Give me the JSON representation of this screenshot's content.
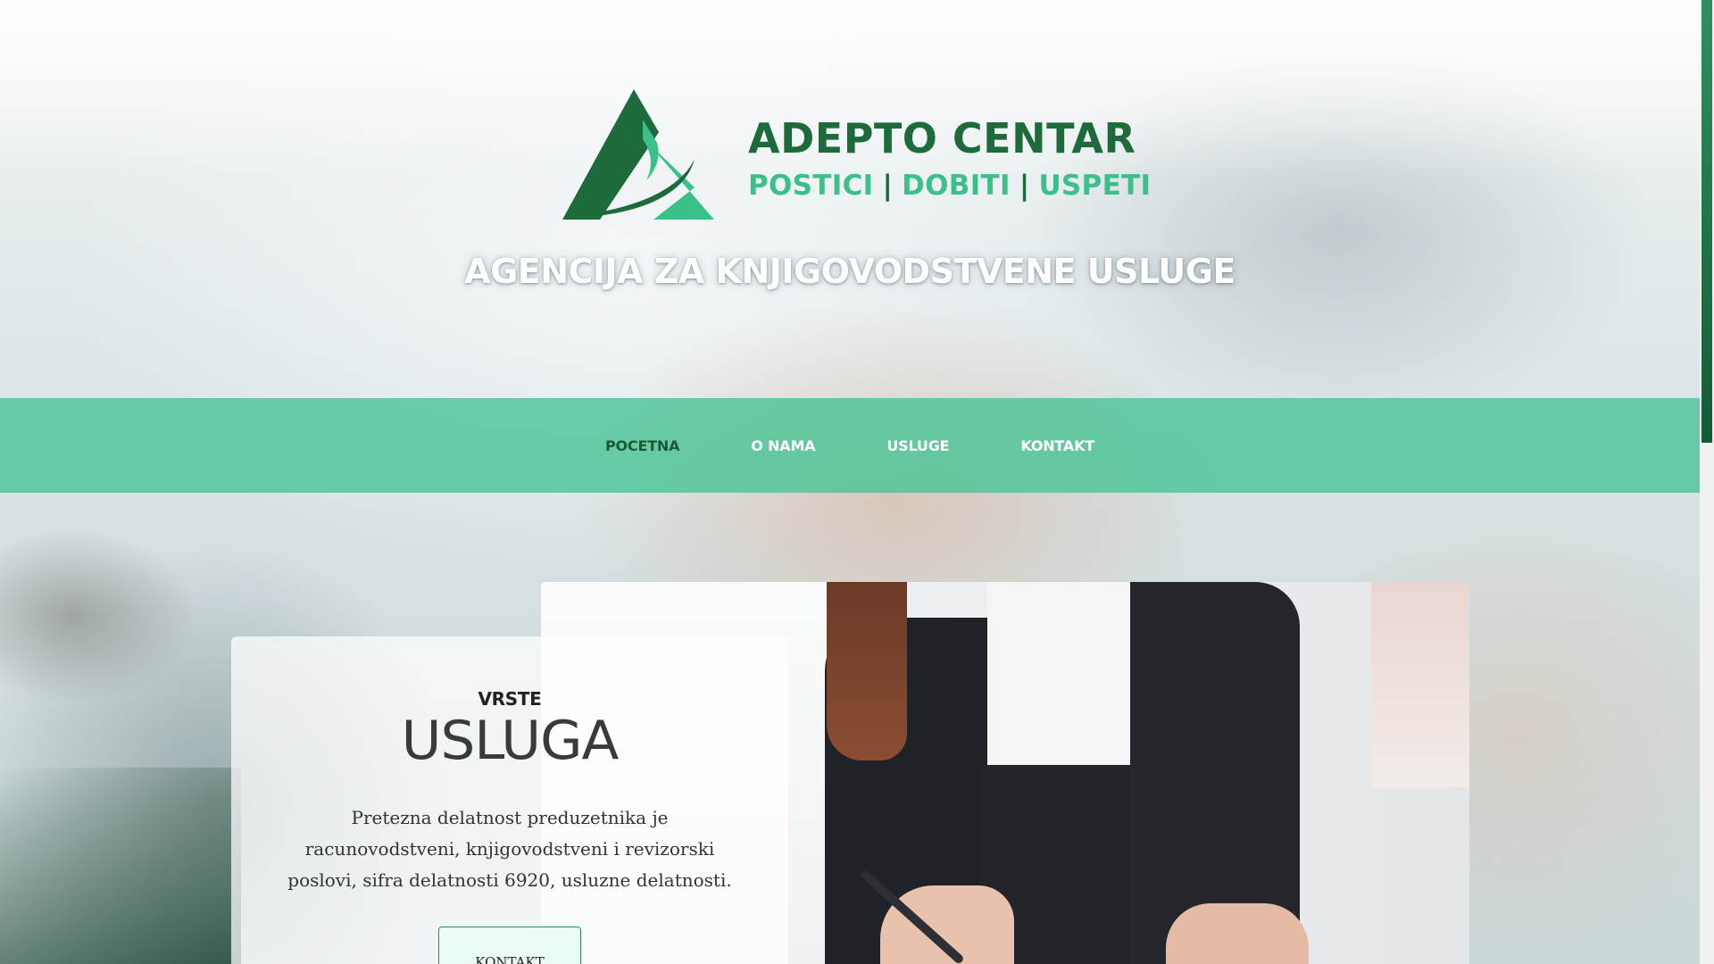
{
  "brand": {
    "name": "ADEPTO CENTAR",
    "tagline_parts": [
      "POSTICI",
      "DOBITI",
      "USPETI"
    ],
    "separator": "|",
    "colors": {
      "dark_green": "#1d6a3b",
      "light_green": "#3cc08a"
    }
  },
  "header": {
    "headline": "AGENCIJA ZA KNJIGOVODSTVENE USLUGE"
  },
  "nav": {
    "items": [
      {
        "label": "POCETNA",
        "active": true
      },
      {
        "label": "O NAMA",
        "active": false
      },
      {
        "label": "USLUGE",
        "active": false
      },
      {
        "label": "KONTAKT",
        "active": false
      }
    ],
    "bar_color": "#4cc496"
  },
  "services_card": {
    "kicker": "VRSTE",
    "title": "USLUGA",
    "text": "Pretezna delatnost preduzetnika je racunovodstveni, knjigovodstveni i revizorski poslovi, sifra delatnosti 6920, usluzne delatnosti.",
    "button_label": "KONTAKT"
  }
}
